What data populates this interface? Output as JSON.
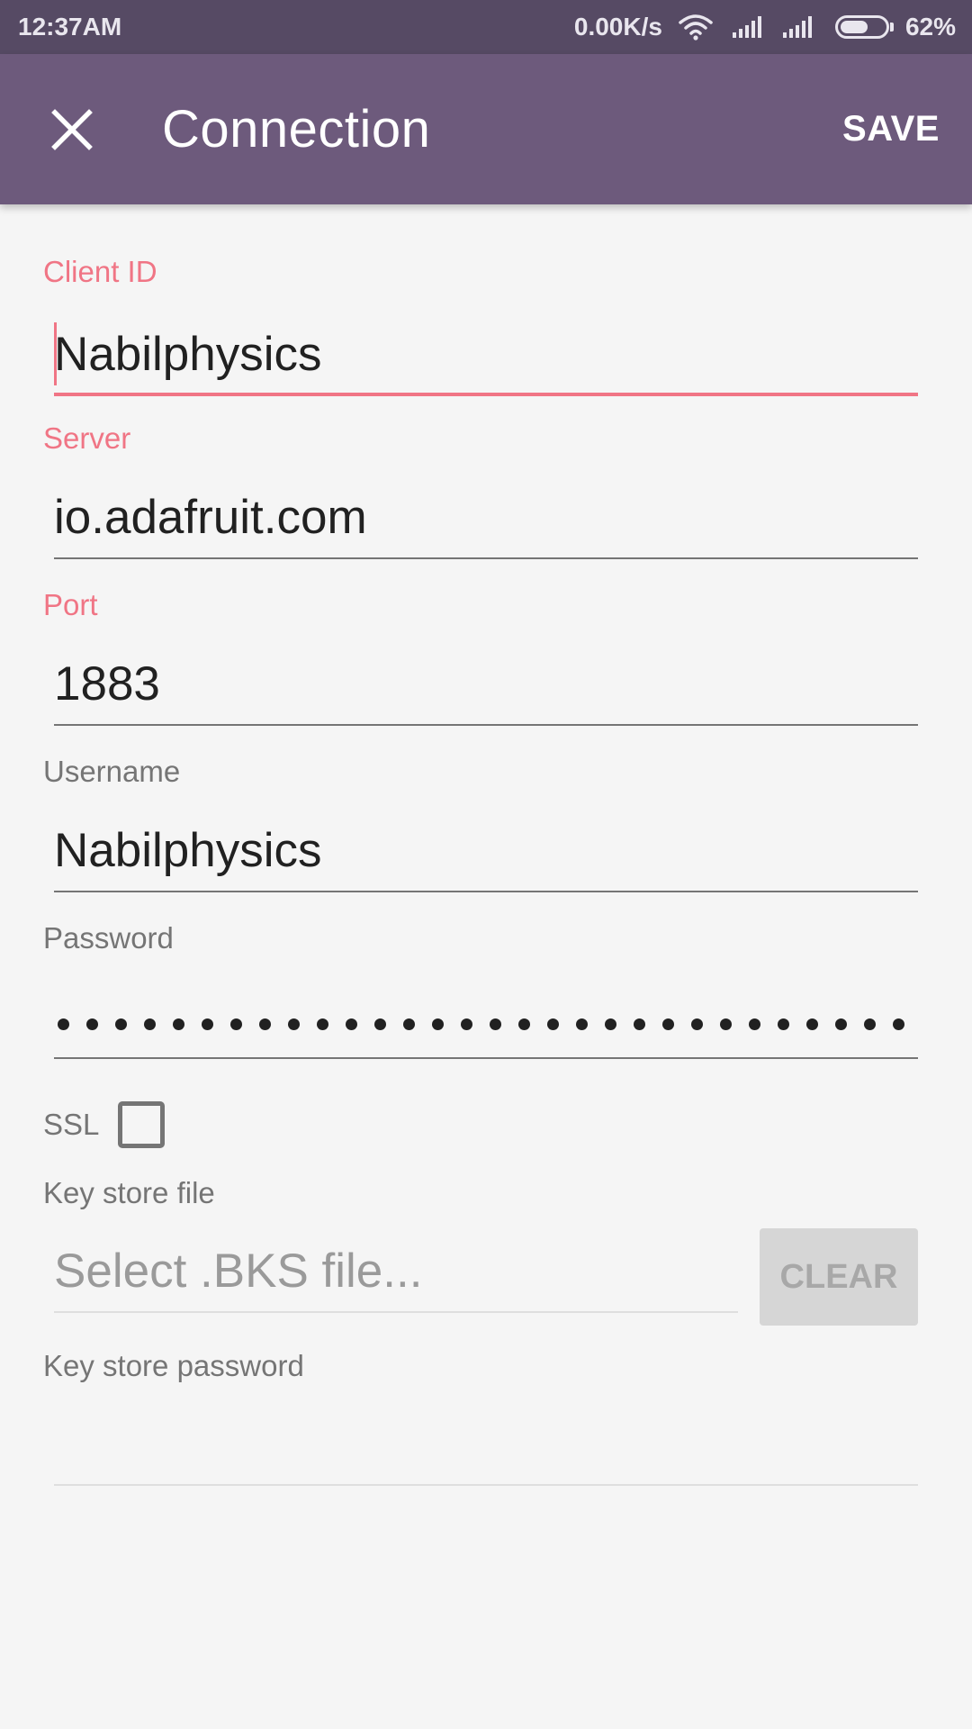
{
  "status_bar": {
    "time": "12:37AM",
    "net_speed": "0.00K/s",
    "battery_text": "62%",
    "battery_level": 0.62,
    "icons": [
      "wifi-icon",
      "signal-icon",
      "signal-icon",
      "battery-icon"
    ]
  },
  "app_bar": {
    "close_icon": "close-icon",
    "title": "Connection",
    "save_label": "SAVE"
  },
  "form": {
    "client_id": {
      "label": "Client ID",
      "value": "Nabilphysics"
    },
    "server": {
      "label": "Server",
      "value": "io.adafruit.com"
    },
    "port": {
      "label": "Port",
      "value": "1883"
    },
    "username": {
      "label": "Username",
      "value": "Nabilphysics"
    },
    "password": {
      "label": "Password",
      "masked_length": 30
    },
    "ssl": {
      "label": "SSL",
      "checked": false
    },
    "key_store_file": {
      "label": "Key store file",
      "placeholder": "Select .BKS file...",
      "clear_label": "CLEAR"
    },
    "key_store_password": {
      "label": "Key store password",
      "value": ""
    }
  },
  "colors": {
    "status_bar": "#564a64",
    "app_bar": "#6d5a7c",
    "accent": "#f07585",
    "background": "#f5f5f5"
  }
}
